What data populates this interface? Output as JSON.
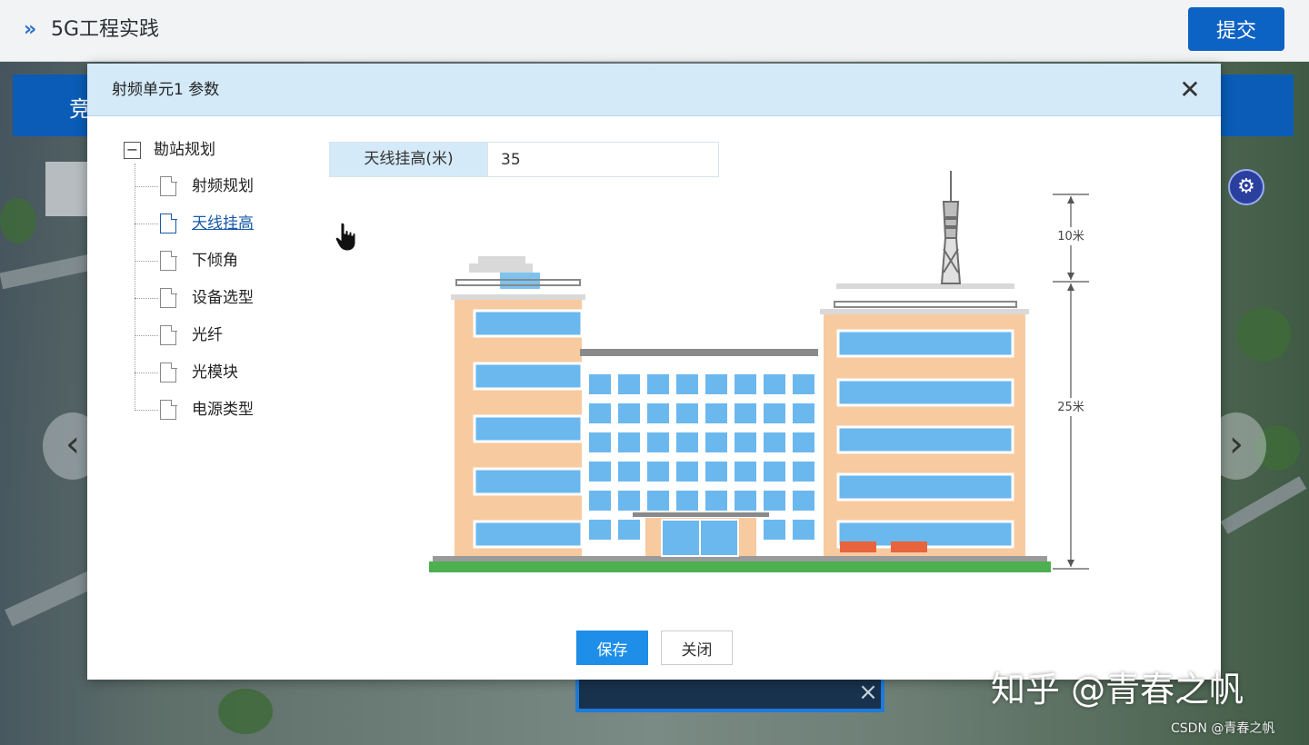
{
  "app": {
    "title": "5G工程实践",
    "submit_label": "提交",
    "banner_text": "竞"
  },
  "modal": {
    "title": "射频单元1 参数",
    "close_glyph": "✕",
    "tree": {
      "root": {
        "toggle": "−",
        "label": "勘站规划"
      },
      "items": [
        {
          "label": "射频规划",
          "active": false
        },
        {
          "label": "天线挂高",
          "active": true
        },
        {
          "label": "下倾角",
          "active": false
        },
        {
          "label": "设备选型",
          "active": false
        },
        {
          "label": "光纤",
          "active": false
        },
        {
          "label": "光模块",
          "active": false
        },
        {
          "label": "电源类型",
          "active": false
        }
      ]
    },
    "field": {
      "label": "天线挂高(米)",
      "value": "35"
    },
    "illustration": {
      "top_dimension": "10米",
      "bottom_dimension": "25米"
    },
    "buttons": {
      "save": "保存",
      "close": "关闭"
    }
  },
  "watermark": {
    "main": "知乎 @青春之帆",
    "small": "CSDN @青春之帆"
  },
  "colors": {
    "primary": "#0d63c4",
    "modal_header": "#d4eaf8",
    "save_button": "#1e8ee8"
  }
}
